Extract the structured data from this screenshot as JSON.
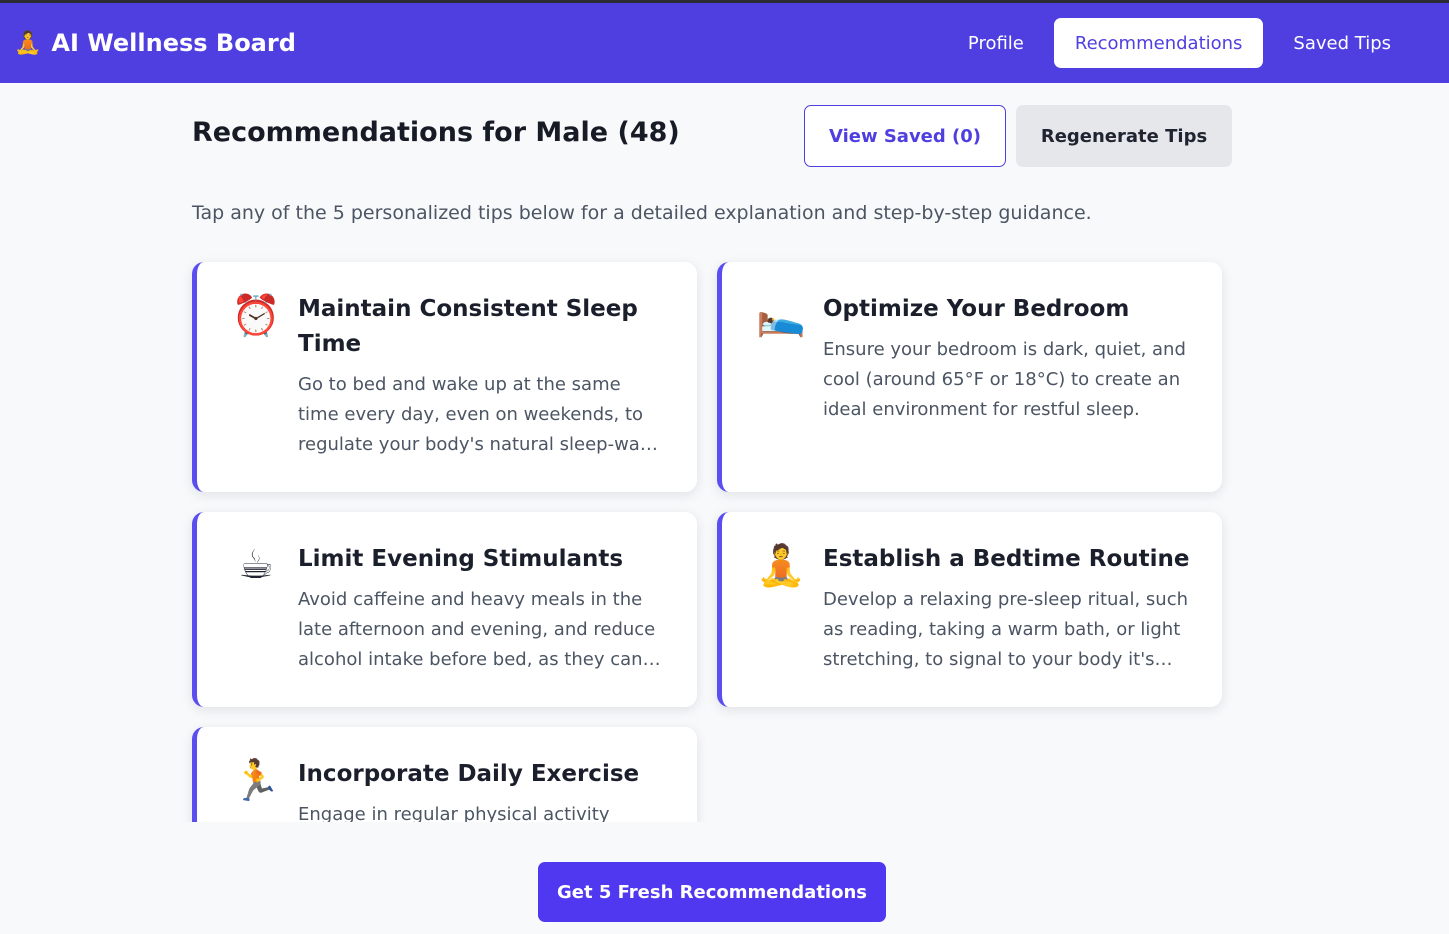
{
  "app": {
    "title": "AI Wellness Board",
    "logo_icon": "🧘"
  },
  "nav": [
    {
      "label": "Profile",
      "active": false
    },
    {
      "label": "Recommendations",
      "active": true
    },
    {
      "label": "Saved Tips",
      "active": false
    }
  ],
  "header": {
    "title": "Recommendations for Male (48)",
    "view_saved_label": "View Saved (0)",
    "regenerate_label": "Regenerate Tips"
  },
  "intro": "Tap any of the 5 personalized tips below for a detailed explanation and step-by-step guidance.",
  "tips": [
    {
      "icon": "⏰",
      "icon_name": "alarm-clock-icon",
      "title": "Maintain Consistent Sleep Time",
      "description": "Go to bed and wake up at the same time every day, even on weekends, to regulate your body's natural sleep-wake cycle."
    },
    {
      "icon": "🛌",
      "icon_name": "bed-icon",
      "title": "Optimize Your Bedroom",
      "description": "Ensure your bedroom is dark, quiet, and cool (around 65°F or 18°C) to create an ideal environment for restful sleep."
    },
    {
      "icon": "☕",
      "icon_name": "coffee-icon",
      "title": "Limit Evening Stimulants",
      "description": "Avoid caffeine and heavy meals in the late afternoon and evening, and reduce alcohol intake before bed, as they can disrupt sleep."
    },
    {
      "icon": "🧘",
      "icon_name": "meditation-icon",
      "title": "Establish a Bedtime Routine",
      "description": "Develop a relaxing pre-sleep ritual, such as reading, taking a warm bath, or light stretching, to signal to your body it's time to wind down."
    },
    {
      "icon": "🏃",
      "icon_name": "running-icon",
      "title": "Incorporate Daily Exercise",
      "description": "Engage in regular physical activity"
    }
  ],
  "footer": {
    "fresh_label": "Get 5 Fresh Recommendations"
  },
  "colors": {
    "brand": "#4f3fe0",
    "accent": "#5b4ef0",
    "background": "#f8f9fb"
  }
}
